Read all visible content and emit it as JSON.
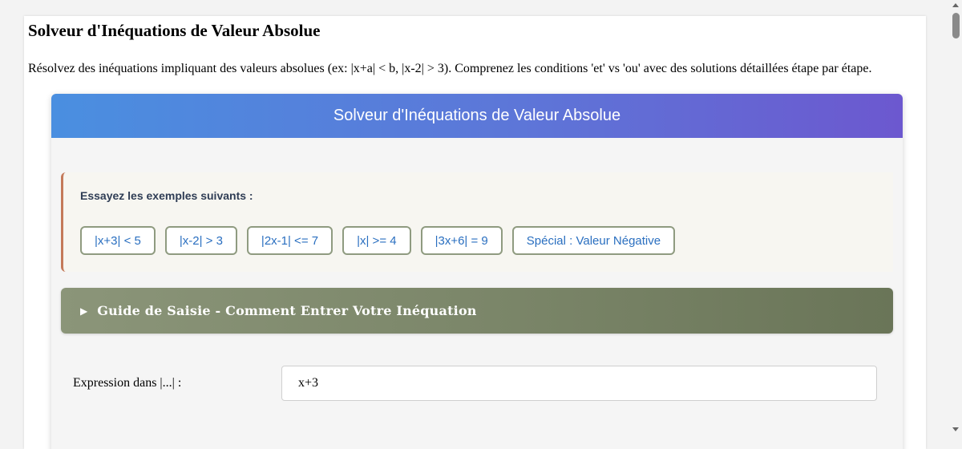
{
  "page": {
    "title": "Solveur d'Inéquations de Valeur Absolue",
    "description": "Résolvez des inéquations impliquant des valeurs absolues (ex: |x+a| < b, |x-2| > 3). Comprenez les conditions 'et' vs 'ou' avec des solutions détaillées étape par étape."
  },
  "card": {
    "header_title": "Solveur d'Inéquations de Valeur Absolue"
  },
  "examples": {
    "label": "Essayez les exemples suivants :",
    "items": [
      "|x+3| < 5",
      "|x-2| > 3",
      "|2x-1| <= 7",
      "|x| >= 4",
      "|3x+6| = 9",
      "Spécial : Valeur Négative"
    ]
  },
  "guide": {
    "arrow": "▶",
    "label": "Guide de Saisie - Comment Entrer Votre Inéquation"
  },
  "form": {
    "expression_label": "Expression dans |...| :",
    "expression_value": "x+3"
  },
  "colors": {
    "header_gradient_start": "#4a8fe0",
    "header_gradient_end": "#6c58cf",
    "example_text": "#2a6fc0",
    "example_border": "#8f9b80",
    "examples_accent": "#c47a5a",
    "guide_bg": "#7a8568"
  }
}
